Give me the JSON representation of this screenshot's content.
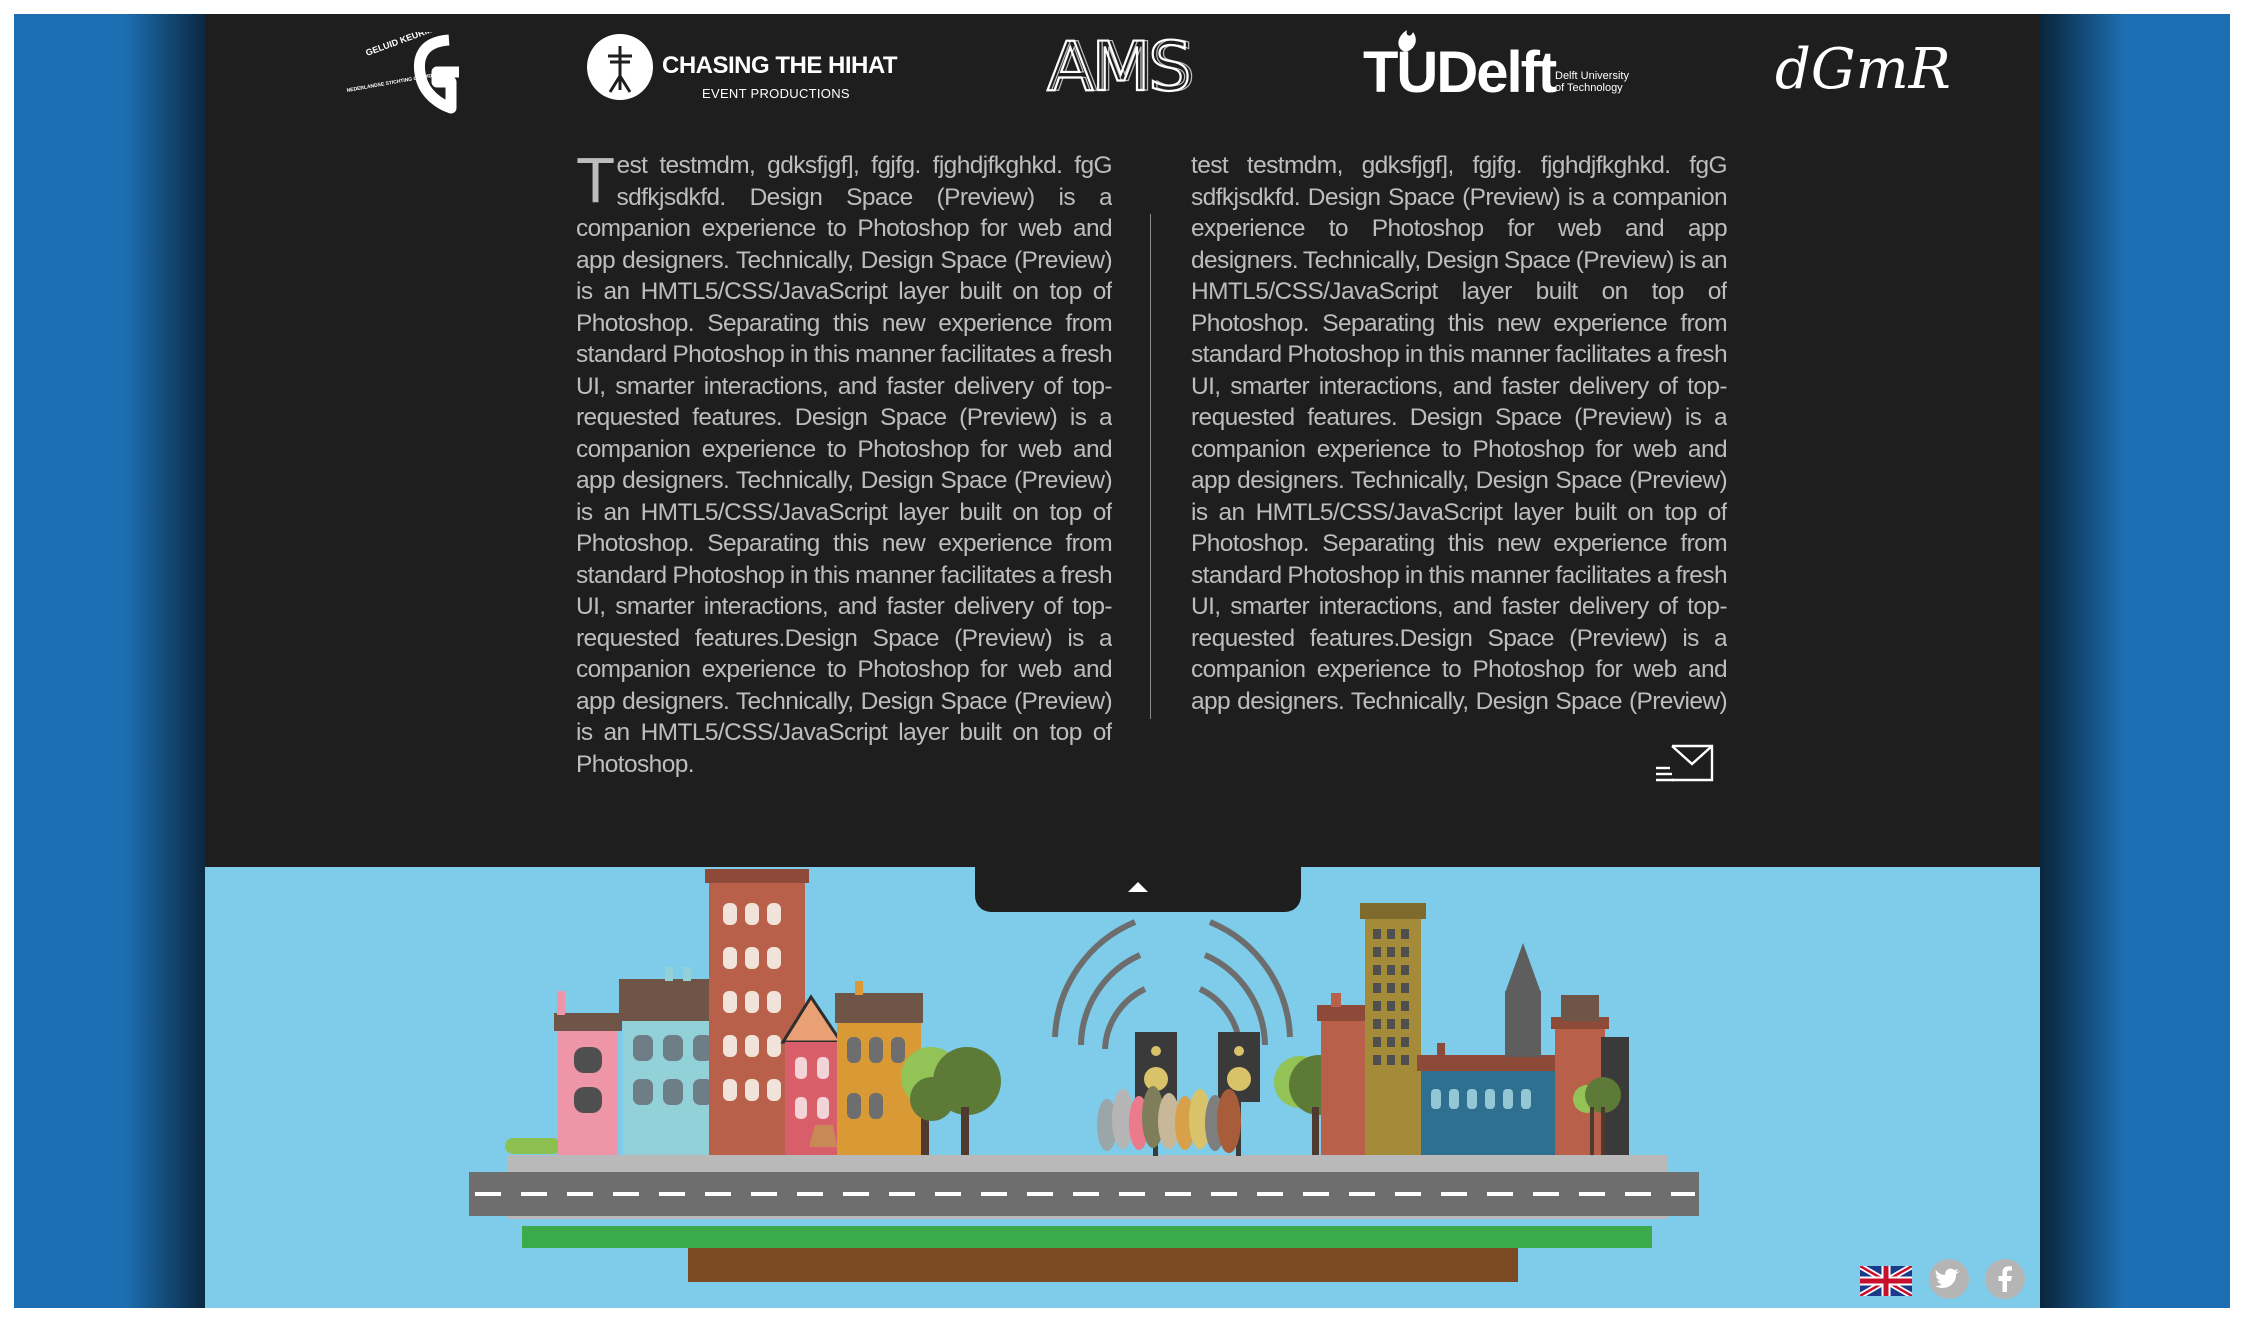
{
  "logos": {
    "geluid_arc_text": "GELUID KEURMERK",
    "geluid_sub_text": "NEDERLANDSE STICHTING GELUIDSHINDER",
    "chasing_title": "CHASING THE HIHAT",
    "chasing_subtitle": "EVENT PRODUCTIONS",
    "ams_text": "AMS",
    "tudelft_main": "TUDelft",
    "tudelft_sub": "Delft University of Technology",
    "dgmr_text": "dGmR"
  },
  "article": {
    "left_dropcap": "T",
    "left_text": "est testmdm, gdksfjgf], fgjfg. fjghdjfkghkd. fgG sdfkjsdkfd. Design Space (Preview) is a companion experience to Photoshop for web and app designers. Technically, Design Space (Preview) is an HMTL5/CSS/JavaScript layer built on top of Photoshop. Separating this new experience from standard Photoshop in this manner facilitates a fresh UI, smarter interactions, and faster delivery of top-requested features. Design Space (Preview) is a companion experience to Photoshop for web and app designers. Technically, Design Space (Preview) is an HMTL5/CSS/JavaScript layer built on top of Photoshop. Separating this new experience from standard Photoshop in this manner facilitates a fresh UI, smarter interactions, and faster delivery of top-requested features.Design Space (Preview) is a companion experience to Photoshop for web and app designers. Technically, Design Space (Preview) is an HMTL5/CSS/JavaScript layer built on top of Photoshop.",
    "right_text": "test testmdm, gdksfjgf], fgjfg. fjghdjfkghkd. fgG sdfkjsdkfd. Design Space (Preview) is a companion experience to Photoshop for web and app designers. Technically, Design Space (Preview) is an HMTL5/CSS/JavaScript layer built on top of Photoshop. Separating this new experience from standard Photoshop in this manner facilitates a fresh UI, smarter interactions, and faster delivery of top-requested features. Design Space (Preview) is a companion experience to Photoshop for web and app designers. Technically, Design Space (Preview) is an HMTL5/CSS/JavaScript layer built on top of Photoshop. Separating this new experience from standard Photoshop in this manner facilitates a fresh UI, smarter interactions, and faster delivery of top-requested features.Design Space (Preview) is a companion experience to Photoshop for web and app designers. Technically, Design Space (Preview) is an"
  },
  "icons": {
    "mail": "mail-send-icon",
    "toggle": "caret-up-icon",
    "language": "uk-flag-icon",
    "twitter": "twitter-icon",
    "facebook": "facebook-icon"
  },
  "colors": {
    "page_background": "#1d6fb3",
    "panel_background": "#1f1e1e",
    "body_text": "#bdbdbd",
    "sky": "#7ecbea",
    "road": "#6e6e6e",
    "grass": "#3aaa4a",
    "soil": "#7b4a22"
  }
}
